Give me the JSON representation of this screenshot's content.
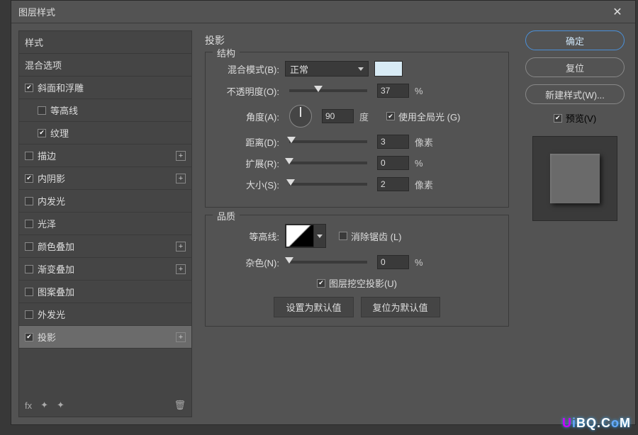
{
  "title": "图层样式",
  "sidebar": {
    "styles": "样式",
    "blend": "混合选项",
    "items": [
      {
        "label": "斜面和浮雕",
        "checked": true,
        "plus": false,
        "indent": false
      },
      {
        "label": "等高线",
        "checked": false,
        "plus": false,
        "indent": true
      },
      {
        "label": "纹理",
        "checked": true,
        "plus": false,
        "indent": true
      },
      {
        "label": "描边",
        "checked": false,
        "plus": true,
        "indent": false
      },
      {
        "label": "内阴影",
        "checked": true,
        "plus": true,
        "indent": false
      },
      {
        "label": "内发光",
        "checked": false,
        "plus": false,
        "indent": false
      },
      {
        "label": "光泽",
        "checked": false,
        "plus": false,
        "indent": false
      },
      {
        "label": "颜色叠加",
        "checked": false,
        "plus": true,
        "indent": false
      },
      {
        "label": "渐变叠加",
        "checked": false,
        "plus": true,
        "indent": false
      },
      {
        "label": "图案叠加",
        "checked": false,
        "plus": false,
        "indent": false
      },
      {
        "label": "外发光",
        "checked": false,
        "plus": false,
        "indent": false
      },
      {
        "label": "投影",
        "checked": true,
        "plus": true,
        "indent": false,
        "selected": true
      }
    ],
    "fx": "fx"
  },
  "center": {
    "title": "投影",
    "structure": "结构",
    "blend_mode_label": "混合模式(B):",
    "blend_mode_value": "正常",
    "opacity_label": "不透明度(O):",
    "opacity_value": "37",
    "opacity_unit": "%",
    "angle_label": "角度(A):",
    "angle_value": "90",
    "angle_unit": "度",
    "global_light": "使用全局光 (G)",
    "distance_label": "距离(D):",
    "distance_value": "3",
    "distance_unit": "像素",
    "spread_label": "扩展(R):",
    "spread_value": "0",
    "spread_unit": "%",
    "size_label": "大小(S):",
    "size_value": "2",
    "size_unit": "像素",
    "quality": "品质",
    "contour_label": "等高线:",
    "antialias": "消除锯齿 (L)",
    "noise_label": "杂色(N):",
    "noise_value": "0",
    "noise_unit": "%",
    "knockout": "图层挖空投影(U)",
    "set_default": "设置为默认值",
    "reset_default": "复位为默认值"
  },
  "right": {
    "ok": "确定",
    "cancel": "复位",
    "new_style": "新建样式(W)...",
    "preview": "预览(V)"
  },
  "watermark": "UiBQ.CoM"
}
